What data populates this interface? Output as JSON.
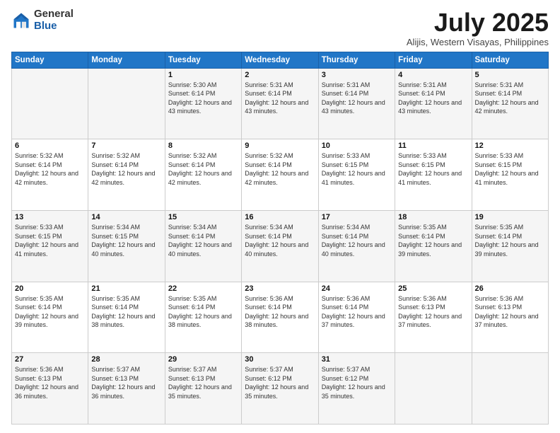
{
  "logo": {
    "general": "General",
    "blue": "Blue"
  },
  "title": "July 2025",
  "location": "Alijis, Western Visayas, Philippines",
  "weekdays": [
    "Sunday",
    "Monday",
    "Tuesday",
    "Wednesday",
    "Thursday",
    "Friday",
    "Saturday"
  ],
  "weeks": [
    [
      {
        "day": "",
        "sunrise": "",
        "sunset": "",
        "daylight": ""
      },
      {
        "day": "",
        "sunrise": "",
        "sunset": "",
        "daylight": ""
      },
      {
        "day": "1",
        "sunrise": "Sunrise: 5:30 AM",
        "sunset": "Sunset: 6:14 PM",
        "daylight": "Daylight: 12 hours and 43 minutes."
      },
      {
        "day": "2",
        "sunrise": "Sunrise: 5:31 AM",
        "sunset": "Sunset: 6:14 PM",
        "daylight": "Daylight: 12 hours and 43 minutes."
      },
      {
        "day": "3",
        "sunrise": "Sunrise: 5:31 AM",
        "sunset": "Sunset: 6:14 PM",
        "daylight": "Daylight: 12 hours and 43 minutes."
      },
      {
        "day": "4",
        "sunrise": "Sunrise: 5:31 AM",
        "sunset": "Sunset: 6:14 PM",
        "daylight": "Daylight: 12 hours and 43 minutes."
      },
      {
        "day": "5",
        "sunrise": "Sunrise: 5:31 AM",
        "sunset": "Sunset: 6:14 PM",
        "daylight": "Daylight: 12 hours and 42 minutes."
      }
    ],
    [
      {
        "day": "6",
        "sunrise": "Sunrise: 5:32 AM",
        "sunset": "Sunset: 6:14 PM",
        "daylight": "Daylight: 12 hours and 42 minutes."
      },
      {
        "day": "7",
        "sunrise": "Sunrise: 5:32 AM",
        "sunset": "Sunset: 6:14 PM",
        "daylight": "Daylight: 12 hours and 42 minutes."
      },
      {
        "day": "8",
        "sunrise": "Sunrise: 5:32 AM",
        "sunset": "Sunset: 6:14 PM",
        "daylight": "Daylight: 12 hours and 42 minutes."
      },
      {
        "day": "9",
        "sunrise": "Sunrise: 5:32 AM",
        "sunset": "Sunset: 6:14 PM",
        "daylight": "Daylight: 12 hours and 42 minutes."
      },
      {
        "day": "10",
        "sunrise": "Sunrise: 5:33 AM",
        "sunset": "Sunset: 6:15 PM",
        "daylight": "Daylight: 12 hours and 41 minutes."
      },
      {
        "day": "11",
        "sunrise": "Sunrise: 5:33 AM",
        "sunset": "Sunset: 6:15 PM",
        "daylight": "Daylight: 12 hours and 41 minutes."
      },
      {
        "day": "12",
        "sunrise": "Sunrise: 5:33 AM",
        "sunset": "Sunset: 6:15 PM",
        "daylight": "Daylight: 12 hours and 41 minutes."
      }
    ],
    [
      {
        "day": "13",
        "sunrise": "Sunrise: 5:33 AM",
        "sunset": "Sunset: 6:15 PM",
        "daylight": "Daylight: 12 hours and 41 minutes."
      },
      {
        "day": "14",
        "sunrise": "Sunrise: 5:34 AM",
        "sunset": "Sunset: 6:15 PM",
        "daylight": "Daylight: 12 hours and 40 minutes."
      },
      {
        "day": "15",
        "sunrise": "Sunrise: 5:34 AM",
        "sunset": "Sunset: 6:14 PM",
        "daylight": "Daylight: 12 hours and 40 minutes."
      },
      {
        "day": "16",
        "sunrise": "Sunrise: 5:34 AM",
        "sunset": "Sunset: 6:14 PM",
        "daylight": "Daylight: 12 hours and 40 minutes."
      },
      {
        "day": "17",
        "sunrise": "Sunrise: 5:34 AM",
        "sunset": "Sunset: 6:14 PM",
        "daylight": "Daylight: 12 hours and 40 minutes."
      },
      {
        "day": "18",
        "sunrise": "Sunrise: 5:35 AM",
        "sunset": "Sunset: 6:14 PM",
        "daylight": "Daylight: 12 hours and 39 minutes."
      },
      {
        "day": "19",
        "sunrise": "Sunrise: 5:35 AM",
        "sunset": "Sunset: 6:14 PM",
        "daylight": "Daylight: 12 hours and 39 minutes."
      }
    ],
    [
      {
        "day": "20",
        "sunrise": "Sunrise: 5:35 AM",
        "sunset": "Sunset: 6:14 PM",
        "daylight": "Daylight: 12 hours and 39 minutes."
      },
      {
        "day": "21",
        "sunrise": "Sunrise: 5:35 AM",
        "sunset": "Sunset: 6:14 PM",
        "daylight": "Daylight: 12 hours and 38 minutes."
      },
      {
        "day": "22",
        "sunrise": "Sunrise: 5:35 AM",
        "sunset": "Sunset: 6:14 PM",
        "daylight": "Daylight: 12 hours and 38 minutes."
      },
      {
        "day": "23",
        "sunrise": "Sunrise: 5:36 AM",
        "sunset": "Sunset: 6:14 PM",
        "daylight": "Daylight: 12 hours and 38 minutes."
      },
      {
        "day": "24",
        "sunrise": "Sunrise: 5:36 AM",
        "sunset": "Sunset: 6:14 PM",
        "daylight": "Daylight: 12 hours and 37 minutes."
      },
      {
        "day": "25",
        "sunrise": "Sunrise: 5:36 AM",
        "sunset": "Sunset: 6:13 PM",
        "daylight": "Daylight: 12 hours and 37 minutes."
      },
      {
        "day": "26",
        "sunrise": "Sunrise: 5:36 AM",
        "sunset": "Sunset: 6:13 PM",
        "daylight": "Daylight: 12 hours and 37 minutes."
      }
    ],
    [
      {
        "day": "27",
        "sunrise": "Sunrise: 5:36 AM",
        "sunset": "Sunset: 6:13 PM",
        "daylight": "Daylight: 12 hours and 36 minutes."
      },
      {
        "day": "28",
        "sunrise": "Sunrise: 5:37 AM",
        "sunset": "Sunset: 6:13 PM",
        "daylight": "Daylight: 12 hours and 36 minutes."
      },
      {
        "day": "29",
        "sunrise": "Sunrise: 5:37 AM",
        "sunset": "Sunset: 6:13 PM",
        "daylight": "Daylight: 12 hours and 35 minutes."
      },
      {
        "day": "30",
        "sunrise": "Sunrise: 5:37 AM",
        "sunset": "Sunset: 6:12 PM",
        "daylight": "Daylight: 12 hours and 35 minutes."
      },
      {
        "day": "31",
        "sunrise": "Sunrise: 5:37 AM",
        "sunset": "Sunset: 6:12 PM",
        "daylight": "Daylight: 12 hours and 35 minutes."
      },
      {
        "day": "",
        "sunrise": "",
        "sunset": "",
        "daylight": ""
      },
      {
        "day": "",
        "sunrise": "",
        "sunset": "",
        "daylight": ""
      }
    ]
  ]
}
